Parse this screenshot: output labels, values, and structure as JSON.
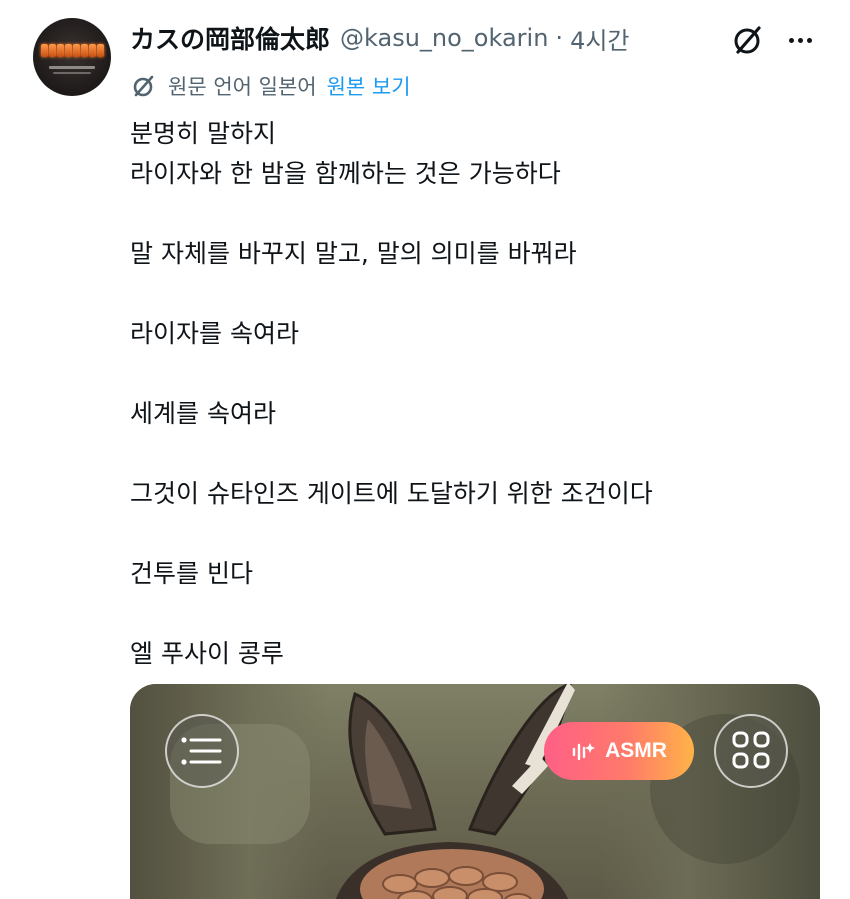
{
  "post": {
    "display_name": "カスの岡部倫太郎",
    "handle": "@kasu_no_okarin",
    "separator": "·",
    "time": "4시간",
    "translation_label": "원문 언어 일본어",
    "show_original": "원본 보기",
    "body_lines": [
      "분명히 말하지",
      "라이자와 한 밤을 함께하는 것은 가능하다",
      "",
      "말 자체를 바꾸지 말고, 말의 의미를 바꿔라",
      "",
      "라이자를 속여라",
      "",
      "세계를 속여라",
      "",
      "그것이 슈타인즈 게이트에 도달하기 위한 조건이다",
      "",
      "건투를 빈다",
      "",
      "엘 푸사이 콩루"
    ]
  },
  "media": {
    "badge_label": "ASMR"
  },
  "icons": {
    "avatar": "avatar-nixie-tube",
    "grok": "grok-icon",
    "more": "more-icon",
    "translate": "translate-icon",
    "menu": "menu-icon",
    "grid": "grid-icon",
    "sound_wave": "sound-wave-icon"
  },
  "colors": {
    "text": "#0f1419",
    "secondary": "#536471",
    "link": "#1d9bf0",
    "badge_start": "#ff5f86",
    "badge_end": "#ffb347"
  }
}
